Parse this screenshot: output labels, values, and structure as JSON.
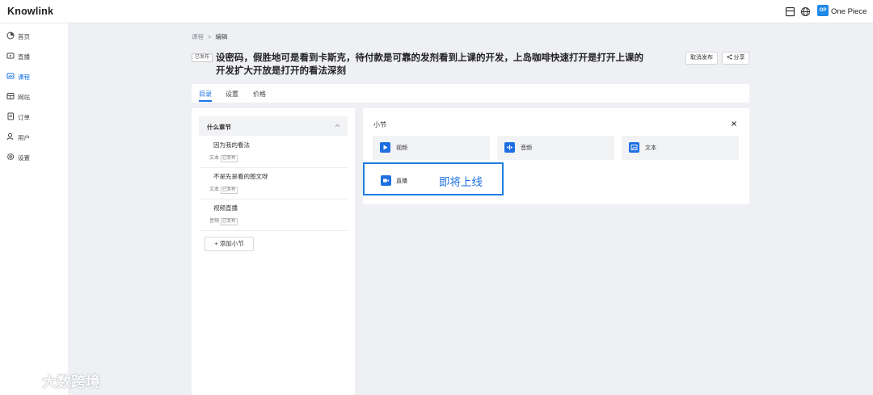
{
  "app": {
    "name": "Knowlink"
  },
  "user": {
    "initials": "OP",
    "name": "One Piece"
  },
  "sidebar": {
    "items": [
      {
        "label": "首页",
        "icon": "dashboard-icon"
      },
      {
        "label": "直播",
        "icon": "live-icon"
      },
      {
        "label": "课程",
        "icon": "course-icon",
        "active": true
      },
      {
        "label": "网站",
        "icon": "website-icon"
      },
      {
        "label": "订单",
        "icon": "order-icon"
      },
      {
        "label": "用户",
        "icon": "user-icon"
      },
      {
        "label": "设置",
        "icon": "gear-icon"
      }
    ]
  },
  "breadcrumb": {
    "parent": "课程",
    "separator": ">",
    "current": "编辑"
  },
  "course": {
    "status": "已发布",
    "title": "设密码，假胜地可是看到卡斯克，待付款是可靠的发剂看到上课的开发，上岛咖啡快速打开是打开上课的开发扩大开放是打开的看法深刻"
  },
  "actions": {
    "unpublish": "取消发布",
    "share": "分享"
  },
  "tabs": [
    {
      "label": "目录",
      "active": true
    },
    {
      "label": "设置"
    },
    {
      "label": "价格"
    }
  ],
  "chapter": {
    "title": "什么章节"
  },
  "lessons": [
    {
      "title": "因为我的看法",
      "type": "文本",
      "status": "已发布"
    },
    {
      "title": "不是先是看的图文呀",
      "type": "文本",
      "status": "已发布"
    },
    {
      "title": "视频直播",
      "type": "音频",
      "status": "已发布"
    }
  ],
  "add_lesson_label": "+ 添加小节",
  "section_panel": {
    "title": "小节",
    "types": [
      {
        "label": "视频",
        "icon": "video-icon"
      },
      {
        "label": "音频",
        "icon": "audio-icon"
      },
      {
        "label": "文本",
        "icon": "text-icon"
      }
    ],
    "live": {
      "label": "直播",
      "icon": "live-camera-icon",
      "badge": "即将上线"
    }
  },
  "watermark": {
    "text": "大数跨境"
  },
  "colors": {
    "accent": "#1a73e8",
    "icon_blue": "#1e6fe0"
  }
}
